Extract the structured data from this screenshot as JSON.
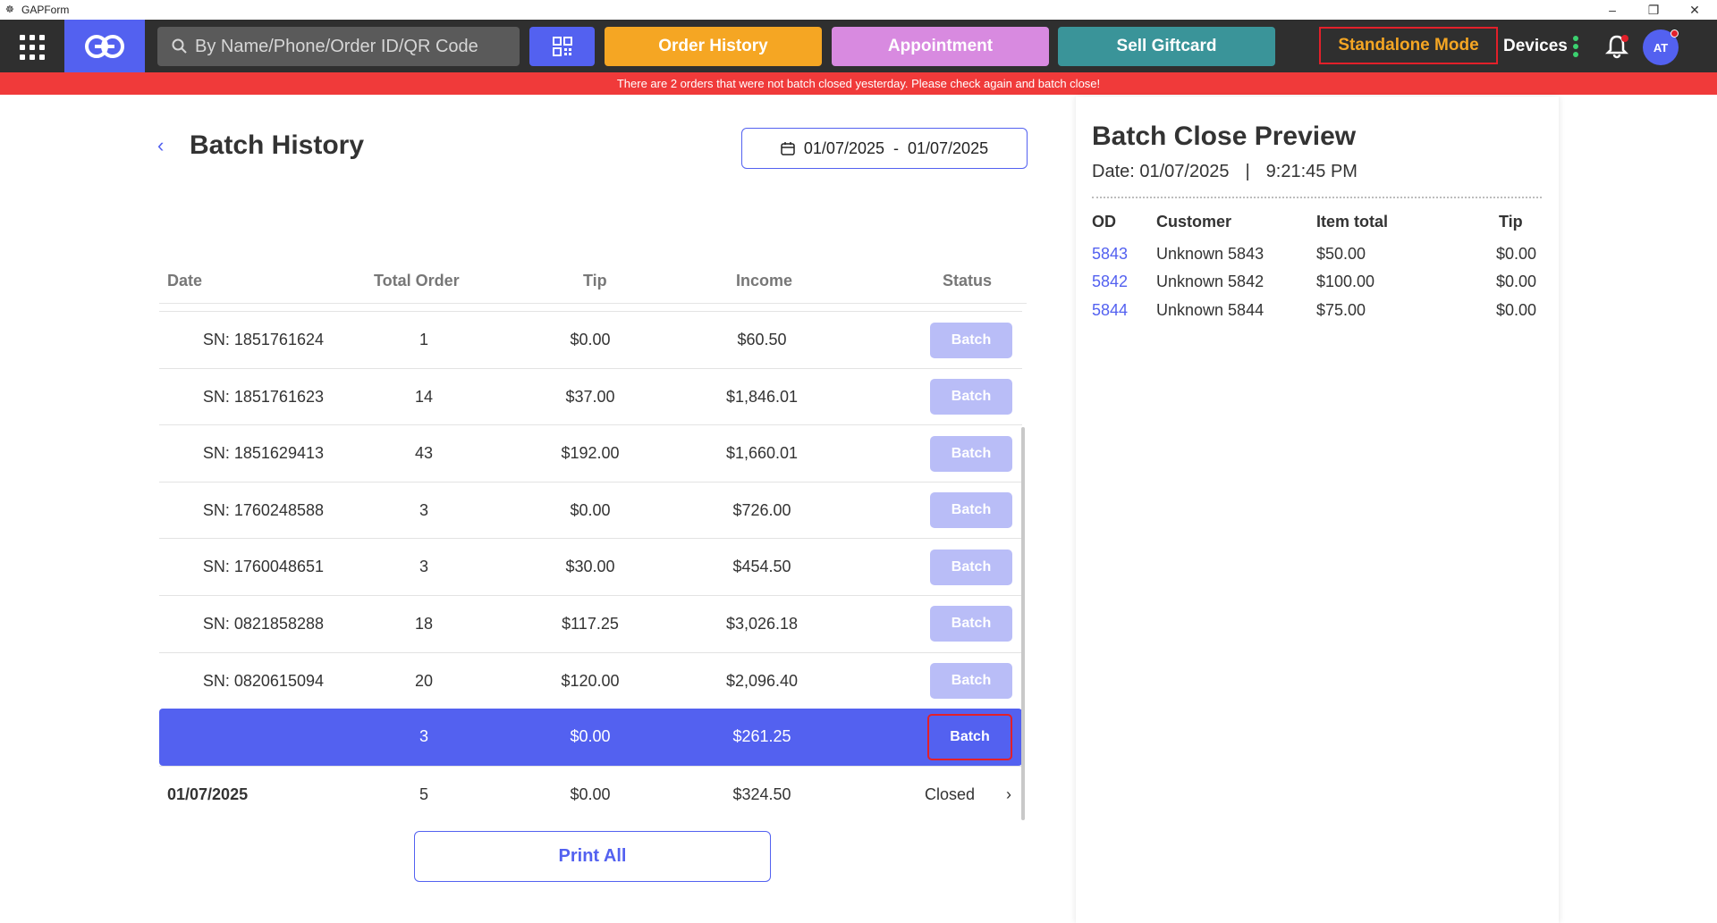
{
  "window": {
    "title": "GAPForm"
  },
  "header": {
    "search_placeholder": "By Name/Phone/Order ID/QR Code",
    "order_history": "Order History",
    "appointment": "Appointment",
    "sell_giftcard": "Sell Giftcard",
    "standalone_mode": "Standalone Mode",
    "devices": "Devices",
    "avatar": "AT"
  },
  "alert": "There are 2 orders that were not batch closed yesterday. Please check again and batch close!",
  "batch_history": {
    "title": "Batch History",
    "date_from": "01/07/2025",
    "date_sep": "-",
    "date_to": "01/07/2025",
    "columns": {
      "date": "Date",
      "total_order": "Total Order",
      "tip": "Tip",
      "income": "Income",
      "status": "Status"
    },
    "rows": [
      {
        "date": "SN: 1851761624",
        "total": "1",
        "tip": "$0.00",
        "income": "$60.50",
        "status": "Batch"
      },
      {
        "date": "SN: 1851761623",
        "total": "14",
        "tip": "$37.00",
        "income": "$1,846.01",
        "status": "Batch"
      },
      {
        "date": "SN: 1851629413",
        "total": "43",
        "tip": "$192.00",
        "income": "$1,660.01",
        "status": "Batch"
      },
      {
        "date": "SN: 1760248588",
        "total": "3",
        "tip": "$0.00",
        "income": "$726.00",
        "status": "Batch"
      },
      {
        "date": "SN: 1760048651",
        "total": "3",
        "tip": "$30.00",
        "income": "$454.50",
        "status": "Batch"
      },
      {
        "date": "SN: 0821858288",
        "total": "18",
        "tip": "$117.25",
        "income": "$3,026.18",
        "status": "Batch"
      },
      {
        "date": "SN: 0820615094",
        "total": "20",
        "tip": "$120.00",
        "income": "$2,096.40",
        "status": "Batch"
      },
      {
        "date": "",
        "total": "3",
        "tip": "$0.00",
        "income": "$261.25",
        "status": "Batch"
      },
      {
        "date": "01/07/2025",
        "total": "5",
        "tip": "$0.00",
        "income": "$324.50",
        "status": "Closed"
      }
    ],
    "print_all": "Print All"
  },
  "preview": {
    "title": "Batch Close Preview",
    "date": "Date: 01/07/2025",
    "sep": "|",
    "time": "9:21:45 PM",
    "columns": {
      "od": "OD",
      "customer": "Customer",
      "item_total": "Item total",
      "tip": "Tip"
    },
    "rows": [
      {
        "od": "5843",
        "customer": "Unknown 5843",
        "item_total": "$50.00",
        "tip": "$0.00"
      },
      {
        "od": "5842",
        "customer": "Unknown 5842",
        "item_total": "$100.00",
        "tip": "$0.00"
      },
      {
        "od": "5844",
        "customer": "Unknown 5844",
        "item_total": "$75.00",
        "tip": "$0.00"
      }
    ]
  },
  "colors": {
    "accent": "#5361f0",
    "order": "#f5a623",
    "appointment": "#d88ae0",
    "giftcard": "#3a9499",
    "alert": "#f03a3a"
  }
}
